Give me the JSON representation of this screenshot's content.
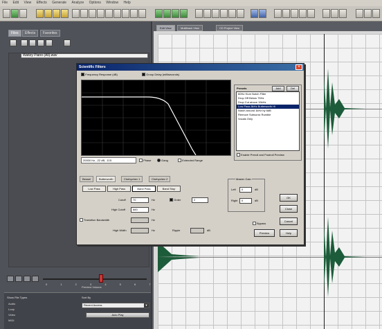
{
  "app": {
    "menu": [
      "File",
      "Edit",
      "View",
      "Effects",
      "Generate",
      "Analyze",
      "Options",
      "Window",
      "Help"
    ]
  },
  "left_panel": {
    "tabs": [
      "Files",
      "Effects",
      "Favorites"
    ],
    "file_item": "Waltzy Piano (All).wav"
  },
  "transport": {
    "ticks": "0 1 2 3 4 5 6 7",
    "label": "Preview Volume"
  },
  "bottom_panel": {
    "show_label": "Show File Types",
    "sort_label": "Sort By",
    "sort_value": "Recent Access",
    "file_types": [
      "Audio",
      "Loop",
      "Video",
      "MIDI"
    ],
    "button_label": "Auto Play"
  },
  "editor": {
    "tabs": [
      "Edit View",
      "Multitrack View",
      "CD Project View"
    ]
  },
  "dialog": {
    "title": "Scientific Filters",
    "graph_tabs": {
      "frequency": "Frequency Response (dB)",
      "group_delay": "Group Delay (milliseconds)"
    },
    "graph_footer": "20000 Hz, -22 dB, -115",
    "graph_options": [
      "Phase",
      "Gang",
      "Extended Range"
    ],
    "presets": {
      "label": "Presets",
      "add": "Add",
      "del": "Del",
      "items": [
        "60Hz Hum Notch Filter",
        "Drop Off Below 75Hz",
        "Drop Cut above 15kHz",
        "Low Pass 8kHz Butterworth Hi",
        "Notch around 1kHz by 6dB",
        "Remove Subsonic Rumble",
        "Vocals Only"
      ],
      "selected_index": 3,
      "enable_preroll": "Enable Preroll and Postroll Preview"
    },
    "filter_tabs": [
      "Bessel",
      "Butterworth",
      "Chebychev 1",
      "Chebychev 2"
    ],
    "filter_types": [
      "Low Pass",
      "High Pass",
      "Band Pass",
      "Band Stop"
    ],
    "params": {
      "cutoff_label": "Cutoff",
      "cutoff_value": "70",
      "hz": "Hz",
      "order_label": "Order",
      "order_value": "2",
      "high_cutoff_label": "High Cutoff",
      "high_cutoff_value": "660",
      "transition_label": "Transition Bandwidth",
      "high_width_label": "High Width",
      "ripple_label": "Ripple",
      "db": "dB"
    },
    "master_gain": {
      "label": "Master Gain",
      "left": "Left",
      "right": "Right",
      "left_value": "0",
      "right_value": "0",
      "db": "dB"
    },
    "bypass": "Bypass",
    "buttons": [
      "OK",
      "Close",
      "Cancel",
      "Preview",
      "Help"
    ]
  },
  "colors": {
    "waveform": "#1d5c3a",
    "filter_curve": "#ffffff",
    "title_bar": "#0a246a"
  }
}
